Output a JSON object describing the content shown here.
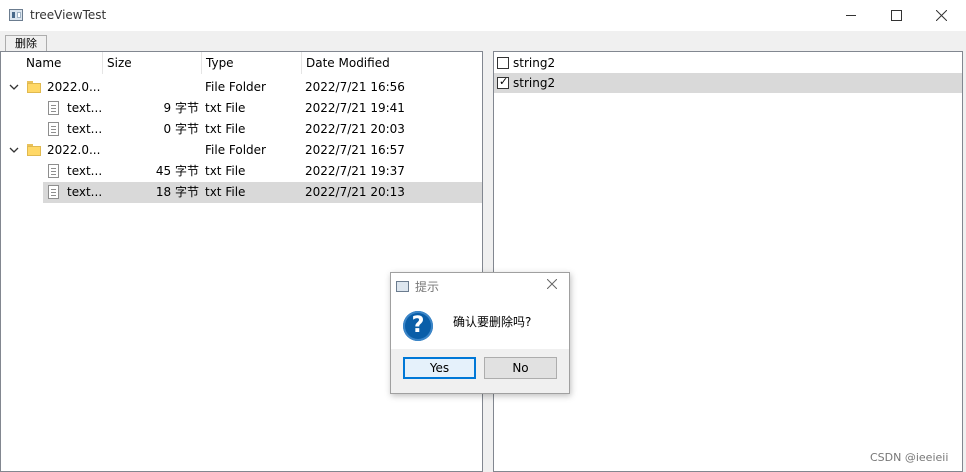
{
  "window": {
    "title": "treeViewTest",
    "minimize_icon": "minimize-icon",
    "maximize_icon": "maximize-icon",
    "close_icon": "close-icon"
  },
  "toolbar": {
    "delete_label": "删除"
  },
  "tree": {
    "headers": [
      "Name",
      "Size",
      "Type",
      "Date Modified"
    ],
    "rows": [
      {
        "name": "2022.0...",
        "size": "",
        "type": "File Folder",
        "date": "2022/7/21 16:56",
        "icon": "folder-icon",
        "expander": "chevron-down-icon"
      },
      {
        "name": "text...",
        "size": "9 字节",
        "type": "txt File",
        "date": "2022/7/21 19:41",
        "icon": "file-icon"
      },
      {
        "name": "text...",
        "size": "0 字节",
        "type": "txt File",
        "date": "2022/7/21 20:03",
        "icon": "file-icon"
      },
      {
        "name": "2022.0...",
        "size": "",
        "type": "File Folder",
        "date": "2022/7/21 16:57",
        "icon": "folder-icon",
        "expander": "chevron-down-icon"
      },
      {
        "name": "text...",
        "size": "45 字节",
        "type": "txt File",
        "date": "2022/7/21 19:37",
        "icon": "file-icon"
      },
      {
        "name": "text...",
        "size": "18 字节",
        "type": "txt File",
        "date": "2022/7/21 20:13",
        "icon": "file-icon",
        "selected": true
      }
    ]
  },
  "list": {
    "items": [
      {
        "label": "string2",
        "checked": false
      },
      {
        "label": "string2",
        "checked": true,
        "selected": true
      }
    ]
  },
  "dialog": {
    "title": "提示",
    "message": "确认要删除吗?",
    "icon": "question-icon",
    "question_glyph": "?",
    "yes_label": "Yes",
    "no_label": "No"
  },
  "watermark": "CSDN @ieeieii",
  "colors": {
    "selection": "#d9d9d9",
    "focus_border": "#0078d7",
    "folder": "#ffd867",
    "question_icon": "#0a5ea8"
  }
}
